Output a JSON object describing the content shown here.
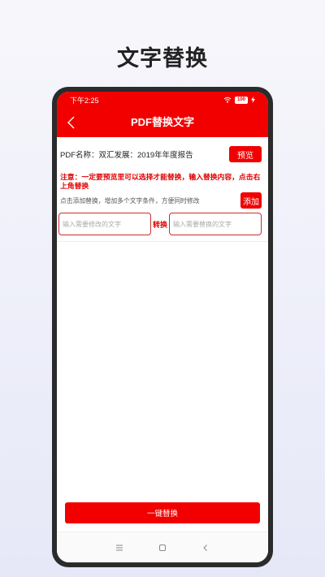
{
  "promo": {
    "title": "文字替换"
  },
  "status_bar": {
    "time": "下午2:25",
    "battery": "100"
  },
  "nav": {
    "title": "PDF替换文字"
  },
  "pdf": {
    "name_text": "PDF名称：双汇发展：2019年年度报告",
    "preview_label": "预览"
  },
  "notice": "注意：一定要预览里可以选择才能替换，输入替换内容，点击右上角替换",
  "hint": {
    "text": "点击添加替换，增加多个文字条件，方便同时修改",
    "add_label": "添加"
  },
  "inputs": {
    "source_placeholder": "输入需要修改的文字",
    "convert_label": "转换",
    "target_placeholder": "输入需要替换的文字"
  },
  "action": {
    "one_click_label": "一键替换"
  },
  "colors": {
    "accent": "#f20000",
    "input_border": "#c63030"
  }
}
